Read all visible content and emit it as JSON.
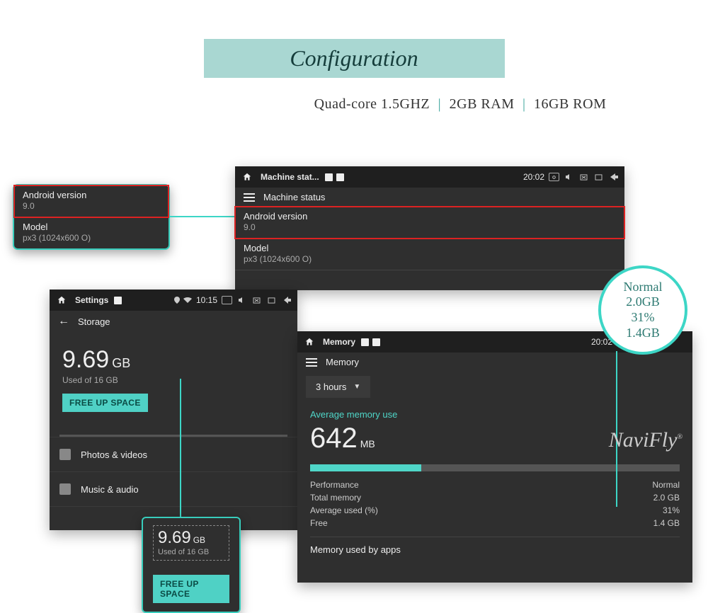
{
  "title": "Configuration",
  "specs": {
    "cpu": "Quad-core  1.5GHZ",
    "ram": "2GB RAM",
    "rom": "16GB ROM"
  },
  "callout_version": {
    "android_label": "Android version",
    "android_value": "9.0",
    "model_label": "Model",
    "model_value": "px3 (1024x600 O)"
  },
  "machine": {
    "top_title": "Machine stat...",
    "time": "20:02",
    "sub_title": "Machine status",
    "android_label": "Android version",
    "android_value": "9.0",
    "model_label": "Model",
    "model_value": "px3 (1024x600 O)"
  },
  "settings": {
    "top_title": "Settings",
    "time": "10:15",
    "sub_title": "Storage",
    "used_num": "9.69",
    "used_unit": "GB",
    "used_sub": "Used of 16 GB",
    "free_btn": "FREE UP SPACE",
    "section1": "Photos & videos",
    "section2": "Music & audio"
  },
  "memory": {
    "top_title": "Memory",
    "time": "20:02",
    "sub_title": "Memory",
    "dropdown": "3 hours",
    "avg_label": "Average memory use",
    "avg_num": "642",
    "avg_unit": "MB",
    "rows": {
      "perf_l": "Performance",
      "perf_v": "Normal",
      "total_l": "Total memory",
      "total_v": "2.0 GB",
      "avg_l": "Average used (%)",
      "avg_v": "31%",
      "free_l": "Free",
      "free_v": "1.4 GB"
    },
    "footer": "Memory used by apps"
  },
  "circle": {
    "l1": "Normal",
    "l2": "2.0GB",
    "l3": "31%",
    "l4": "1.4GB"
  },
  "storage_callout": {
    "num": "9.69",
    "unit": "GB",
    "sub": "Used of 16 GB",
    "btn": "FREE UP SPACE"
  },
  "watermark": "NaviFly"
}
